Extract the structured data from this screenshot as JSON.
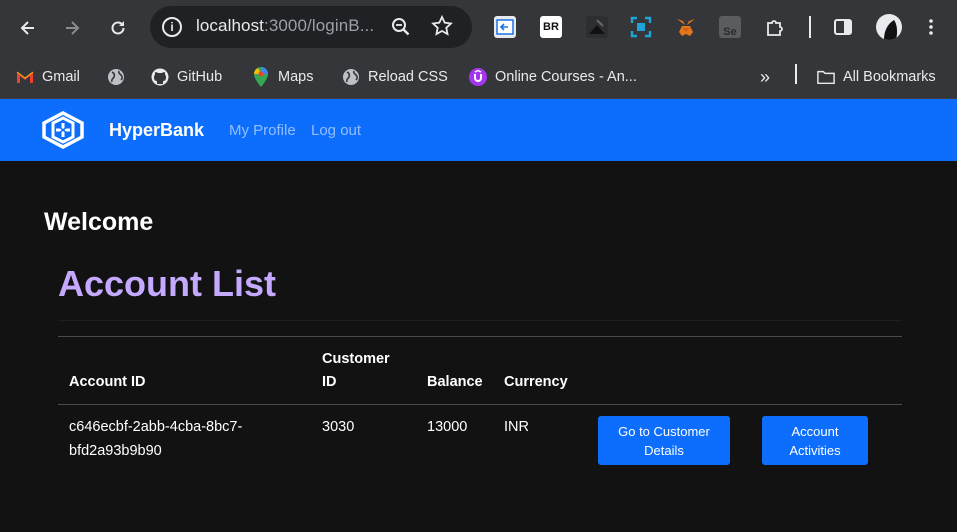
{
  "browser": {
    "url_host": "localhost",
    "url_rest": ":3000/loginB...",
    "bookmarks": [
      {
        "label": "Gmail",
        "icon": "gmail-icon"
      },
      {
        "label": "",
        "icon": "globe-icon"
      },
      {
        "label": "GitHub",
        "icon": "github-icon"
      },
      {
        "label": "Maps",
        "icon": "maps-icon"
      },
      {
        "label": "Reload CSS",
        "icon": "globe-icon"
      },
      {
        "label": "Online Courses - An...",
        "icon": "udemy-icon"
      }
    ],
    "more_bookmarks": "»",
    "all_bookmarks": "All Bookmarks",
    "extensions": [
      "arrow-ext-icon",
      "br-ext-icon",
      "dark-ext-icon",
      "screenshot-ext-icon",
      "metamask-ext-icon",
      "selenium-ext-icon",
      "puzzle-icon"
    ]
  },
  "navbar": {
    "brand": "HyperBank",
    "links": [
      "My Profile",
      "Log out"
    ],
    "bg_color": "#0d6efd"
  },
  "main": {
    "welcome": "Welcome",
    "title": "Account List",
    "title_color": "#c5a9ff",
    "table": {
      "headers": {
        "account_id": "Account ID",
        "customer_id_line1": "Customer",
        "customer_id_line2": "ID",
        "balance": "Balance",
        "currency": "Currency"
      },
      "rows": [
        {
          "account_id_line1": "c646ecbf-2abb-4cba-8bc7-",
          "account_id_line2": "bfd2a93b9b90",
          "customer_id": "3030",
          "balance": "13000",
          "currency": "INR",
          "customer_btn_line1": "Go to Customer",
          "customer_btn_line2": "Details",
          "activities_btn_line1": "Account",
          "activities_btn_line2": "Activities"
        }
      ]
    }
  }
}
